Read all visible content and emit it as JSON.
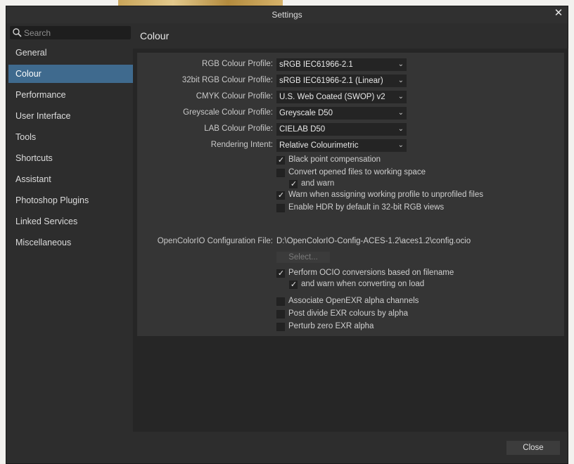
{
  "window": {
    "title": "Settings"
  },
  "search": {
    "placeholder": "Search"
  },
  "sidebar": {
    "items": [
      {
        "label": "General"
      },
      {
        "label": "Colour",
        "active": true
      },
      {
        "label": "Performance"
      },
      {
        "label": "User Interface"
      },
      {
        "label": "Tools"
      },
      {
        "label": "Shortcuts"
      },
      {
        "label": "Assistant"
      },
      {
        "label": "Photoshop Plugins"
      },
      {
        "label": "Linked Services"
      },
      {
        "label": "Miscellaneous"
      }
    ]
  },
  "page": {
    "title": "Colour"
  },
  "profiles": [
    {
      "label": "RGB Colour Profile:",
      "value": "sRGB IEC61966-2.1"
    },
    {
      "label": "32bit RGB Colour Profile:",
      "value": "sRGB IEC61966-2.1 (Linear)"
    },
    {
      "label": "CMYK Colour Profile:",
      "value": "U.S. Web Coated (SWOP) v2"
    },
    {
      "label": "Greyscale Colour Profile:",
      "value": "Greyscale D50"
    },
    {
      "label": "LAB Colour Profile:",
      "value": "CIELAB D50"
    },
    {
      "label": "Rendering Intent:",
      "value": "Relative Colourimetric"
    }
  ],
  "checkboxes": {
    "black_point": {
      "label": "Black point compensation",
      "checked": true
    },
    "convert_opened": {
      "label": "Convert opened files to working space",
      "checked": false
    },
    "and_warn": {
      "label": "and warn",
      "checked": true
    },
    "warn_assigning": {
      "label": "Warn when assigning working profile to unprofiled files",
      "checked": true
    },
    "enable_hdr": {
      "label": "Enable HDR by default in 32-bit RGB views",
      "checked": false
    },
    "perform_ocio": {
      "label": "Perform OCIO conversions based on filename",
      "checked": true
    },
    "warn_converting": {
      "label": "and warn when converting on load",
      "checked": true
    },
    "associate_exr": {
      "label": "Associate OpenEXR alpha channels",
      "checked": false
    },
    "post_divide": {
      "label": "Post divide EXR colours by alpha",
      "checked": false
    },
    "perturb_zero": {
      "label": "Perturb zero EXR alpha",
      "checked": false
    }
  },
  "ocio": {
    "label": "OpenColorIO Configuration File:",
    "value": "D:\\OpenColorIO-Config-ACES-1.2\\aces1.2\\config.ocio",
    "select_label": "Select..."
  },
  "footer": {
    "close_label": "Close"
  },
  "colors": {
    "accent": "#3f6a8e",
    "window_bg": "#2d2d2d",
    "panel_bg": "#353535"
  },
  "icons": {
    "search": "search-icon",
    "close": "close-icon",
    "dropdown": "chevron-down-icon",
    "check": "check-icon"
  }
}
